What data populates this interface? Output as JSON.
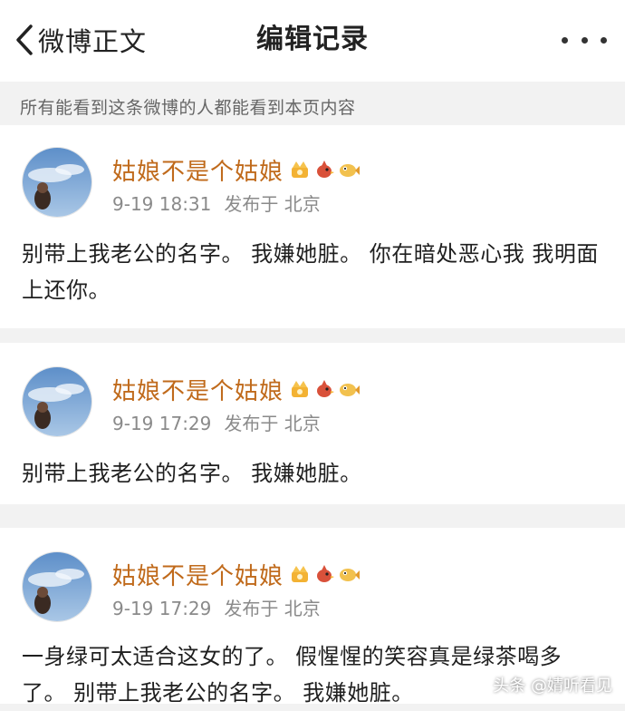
{
  "header": {
    "back_label": "微博正文",
    "title": "编辑记录"
  },
  "notice": "所有能看到这条微博的人都能看到本页内容",
  "records": [
    {
      "user": "姑娘不是个姑娘",
      "time": "9-19 18:31",
      "location": "发布于 北京",
      "content": "别带上我老公的名字。  我嫌她脏。 你在暗处恶心我  我明面上还你。"
    },
    {
      "user": "姑娘不是个姑娘",
      "time": "9-19 17:29",
      "location": "发布于 北京",
      "content": "别带上我老公的名字。 我嫌她脏。"
    },
    {
      "user": "姑娘不是个姑娘",
      "time": "9-19 17:29",
      "location": "发布于 北京",
      "content": "一身绿可太适合这女的了。 假惺惺的笑容真是绿茶喝多了。  别带上我老公的名字。 我嫌她脏。"
    }
  ],
  "badges": [
    "crown-badge-icon",
    "red-bird-badge-icon",
    "yellow-fish-badge-icon"
  ],
  "watermark": "头条 @婧听看见",
  "colors": {
    "username": "#c06a1b",
    "meta": "#8a8a8a",
    "background": "#f2f2f2",
    "card": "#ffffff"
  }
}
